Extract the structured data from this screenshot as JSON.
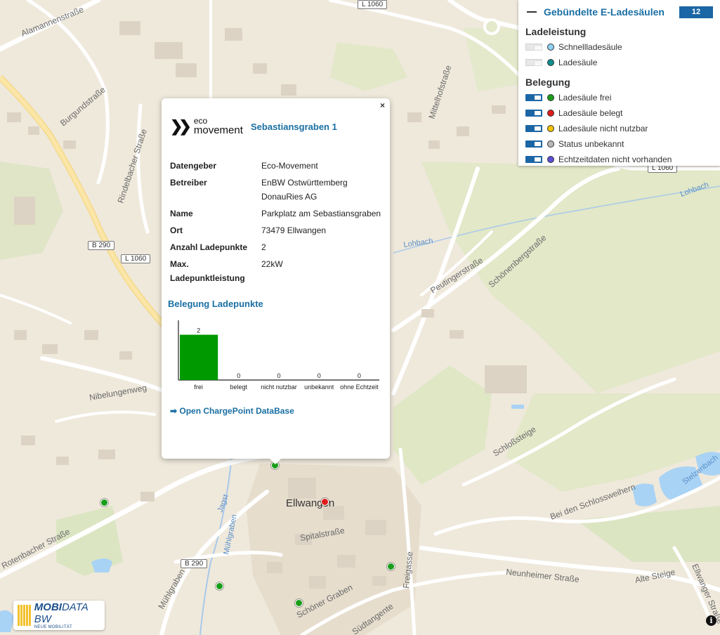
{
  "map": {
    "town_label": "Ellwangen",
    "street_labels": [
      "Alamannenstraße",
      "Burgundstraße",
      "Rindelbacher Straße",
      "Nibelungenweg",
      "Rotenbacher Straße",
      "Mühlgraben",
      "Mühlgraben",
      "Jagst",
      "Spitalstraße",
      "Schöner Graben",
      "Südtangente",
      "Freigasse",
      "Neunheimer Straße",
      "Alte Steige",
      "Ellwanger Straße",
      "Schloßsteige",
      "Bei den Schlossweihern",
      "Stelzenbach",
      "Peutingerstraße",
      "Schönenbergstraße",
      "Lohbach",
      "Lohbach",
      "Mittelhofstraße"
    ],
    "road_shields": [
      "L 1060",
      "B 290",
      "L 1060",
      "B 290",
      "L 1060"
    ],
    "marker_colors": {
      "frei": "#1a9e1a",
      "belegt": "#e01b1b"
    }
  },
  "legend": {
    "title": "Gebündelte E-Ladesäulen",
    "count": "12",
    "sections": [
      {
        "title": "Ladeleistung",
        "items": [
          {
            "label": "Schnellladesäule",
            "color": "#8fd3f4",
            "enabled": false
          },
          {
            "label": "Ladesäule",
            "color": "#0e8f8f",
            "enabled": false
          }
        ]
      },
      {
        "title": "Belegung",
        "items": [
          {
            "label": "Ladesäule frei",
            "color": "#1a9e1a",
            "enabled": true
          },
          {
            "label": "Ladesäule belegt",
            "color": "#e01b1b",
            "enabled": true
          },
          {
            "label": "Ladesäule nicht nutzbar",
            "color": "#f2c200",
            "enabled": true
          },
          {
            "label": "Status unbekannt",
            "color": "#b8b8b8",
            "enabled": true
          },
          {
            "label": "Echtzeitdaten nicht vorhanden",
            "color": "#5b4fd6",
            "enabled": true
          }
        ]
      }
    ]
  },
  "popup": {
    "close_symbol": "×",
    "provider_logo": {
      "line1": "eco",
      "line2": "movement"
    },
    "title": "Sebastiansgraben 1",
    "fields": [
      {
        "label": "Datengeber",
        "value": "Eco-Movement"
      },
      {
        "label": "Betreiber",
        "value": "EnBW Ostwürttemberg DonauRies AG"
      },
      {
        "label": "Name",
        "value": "Parkplatz am Sebastiansgraben"
      },
      {
        "label": "Ort",
        "value": "73479 Ellwangen"
      },
      {
        "label": "Anzahl Ladepunkte",
        "value": "2"
      },
      {
        "label": "Max. Ladepunktleistung",
        "value": "22kW"
      }
    ],
    "chart_title": "Belegung Ladepunkte",
    "link_text": "➡ Open ChargePoint DataBase"
  },
  "chart_data": {
    "type": "bar",
    "categories": [
      "frei",
      "belegt",
      "nicht nutzbar",
      "unbekannt",
      "ohne Echtzeit"
    ],
    "values": [
      2,
      0,
      0,
      0,
      0
    ],
    "bar_color": "#009900",
    "ylim": [
      0,
      2.7
    ]
  },
  "footer": {
    "logo_main": "MOBI",
    "logo_main2": "DATA BW",
    "logo_sub": "NEUE MOBILITÄT",
    "info_symbol": "i"
  }
}
